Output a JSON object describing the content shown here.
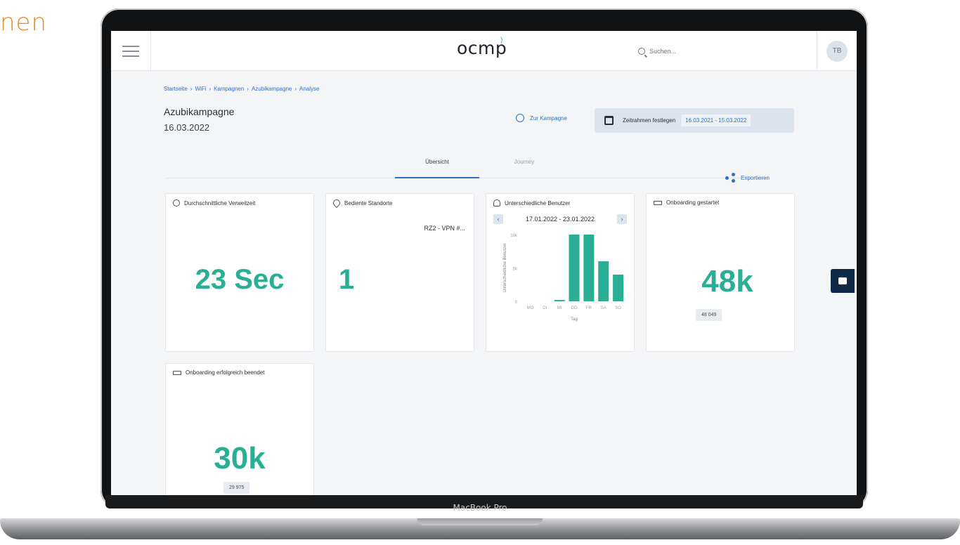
{
  "background_text": "nen",
  "device_label": "MacBook Pro",
  "topbar": {
    "logo": "ocmp",
    "search_placeholder": "Suchen...",
    "avatar_initials": "TB"
  },
  "breadcrumb": [
    "Startseite",
    "WiFi",
    "Kampagnen",
    "Azubikampagne",
    "Analyse"
  ],
  "breadcrumb_separator": "›",
  "header": {
    "title": "Azubikampagne",
    "date": "16.03.2022",
    "to_campaign": "Zur Kampagne",
    "timeframe_label": "Zeitrahmen festlegen",
    "timeframe_range": "16.03.2021 - 15.03.2022"
  },
  "tabs": [
    "Übersicht",
    "Journey"
  ],
  "export_label": "Exportieren",
  "cards": {
    "dwell": {
      "title": "Durchschnittliche Verweilzeit",
      "value": "23 Sec"
    },
    "locations": {
      "title": "Bediente Standorte",
      "value": "1",
      "location": "RZ2 - VPN #..."
    },
    "users": {
      "title": "Unterschiedliche Benutzer",
      "range": "17.01.2022 - 23.01.2022"
    },
    "onboarding_started": {
      "title": "Onboarding gestartet",
      "value": "48k",
      "exact": "48 049"
    },
    "onboarding_done": {
      "title": "Onboarding erfolgreich beendet",
      "value": "30k",
      "exact": "29 975"
    }
  },
  "colors": {
    "accent": "#2aae94",
    "link": "#2f6fc4",
    "background_text": "#e8892a",
    "chat_button": "#0e2a47"
  },
  "chart_data": {
    "type": "bar",
    "categories": [
      "MO",
      "DI",
      "MI",
      "DO",
      "FR",
      "SA",
      "SO"
    ],
    "values": [
      0,
      0,
      200,
      10000,
      10000,
      6000,
      4000
    ],
    "xlabel": "Tag",
    "ylabel": "Unterschiedliche Benutzer",
    "ylim": [
      0,
      10000
    ],
    "yticks": [
      "0",
      "5k",
      "10k"
    ],
    "grid": false
  }
}
